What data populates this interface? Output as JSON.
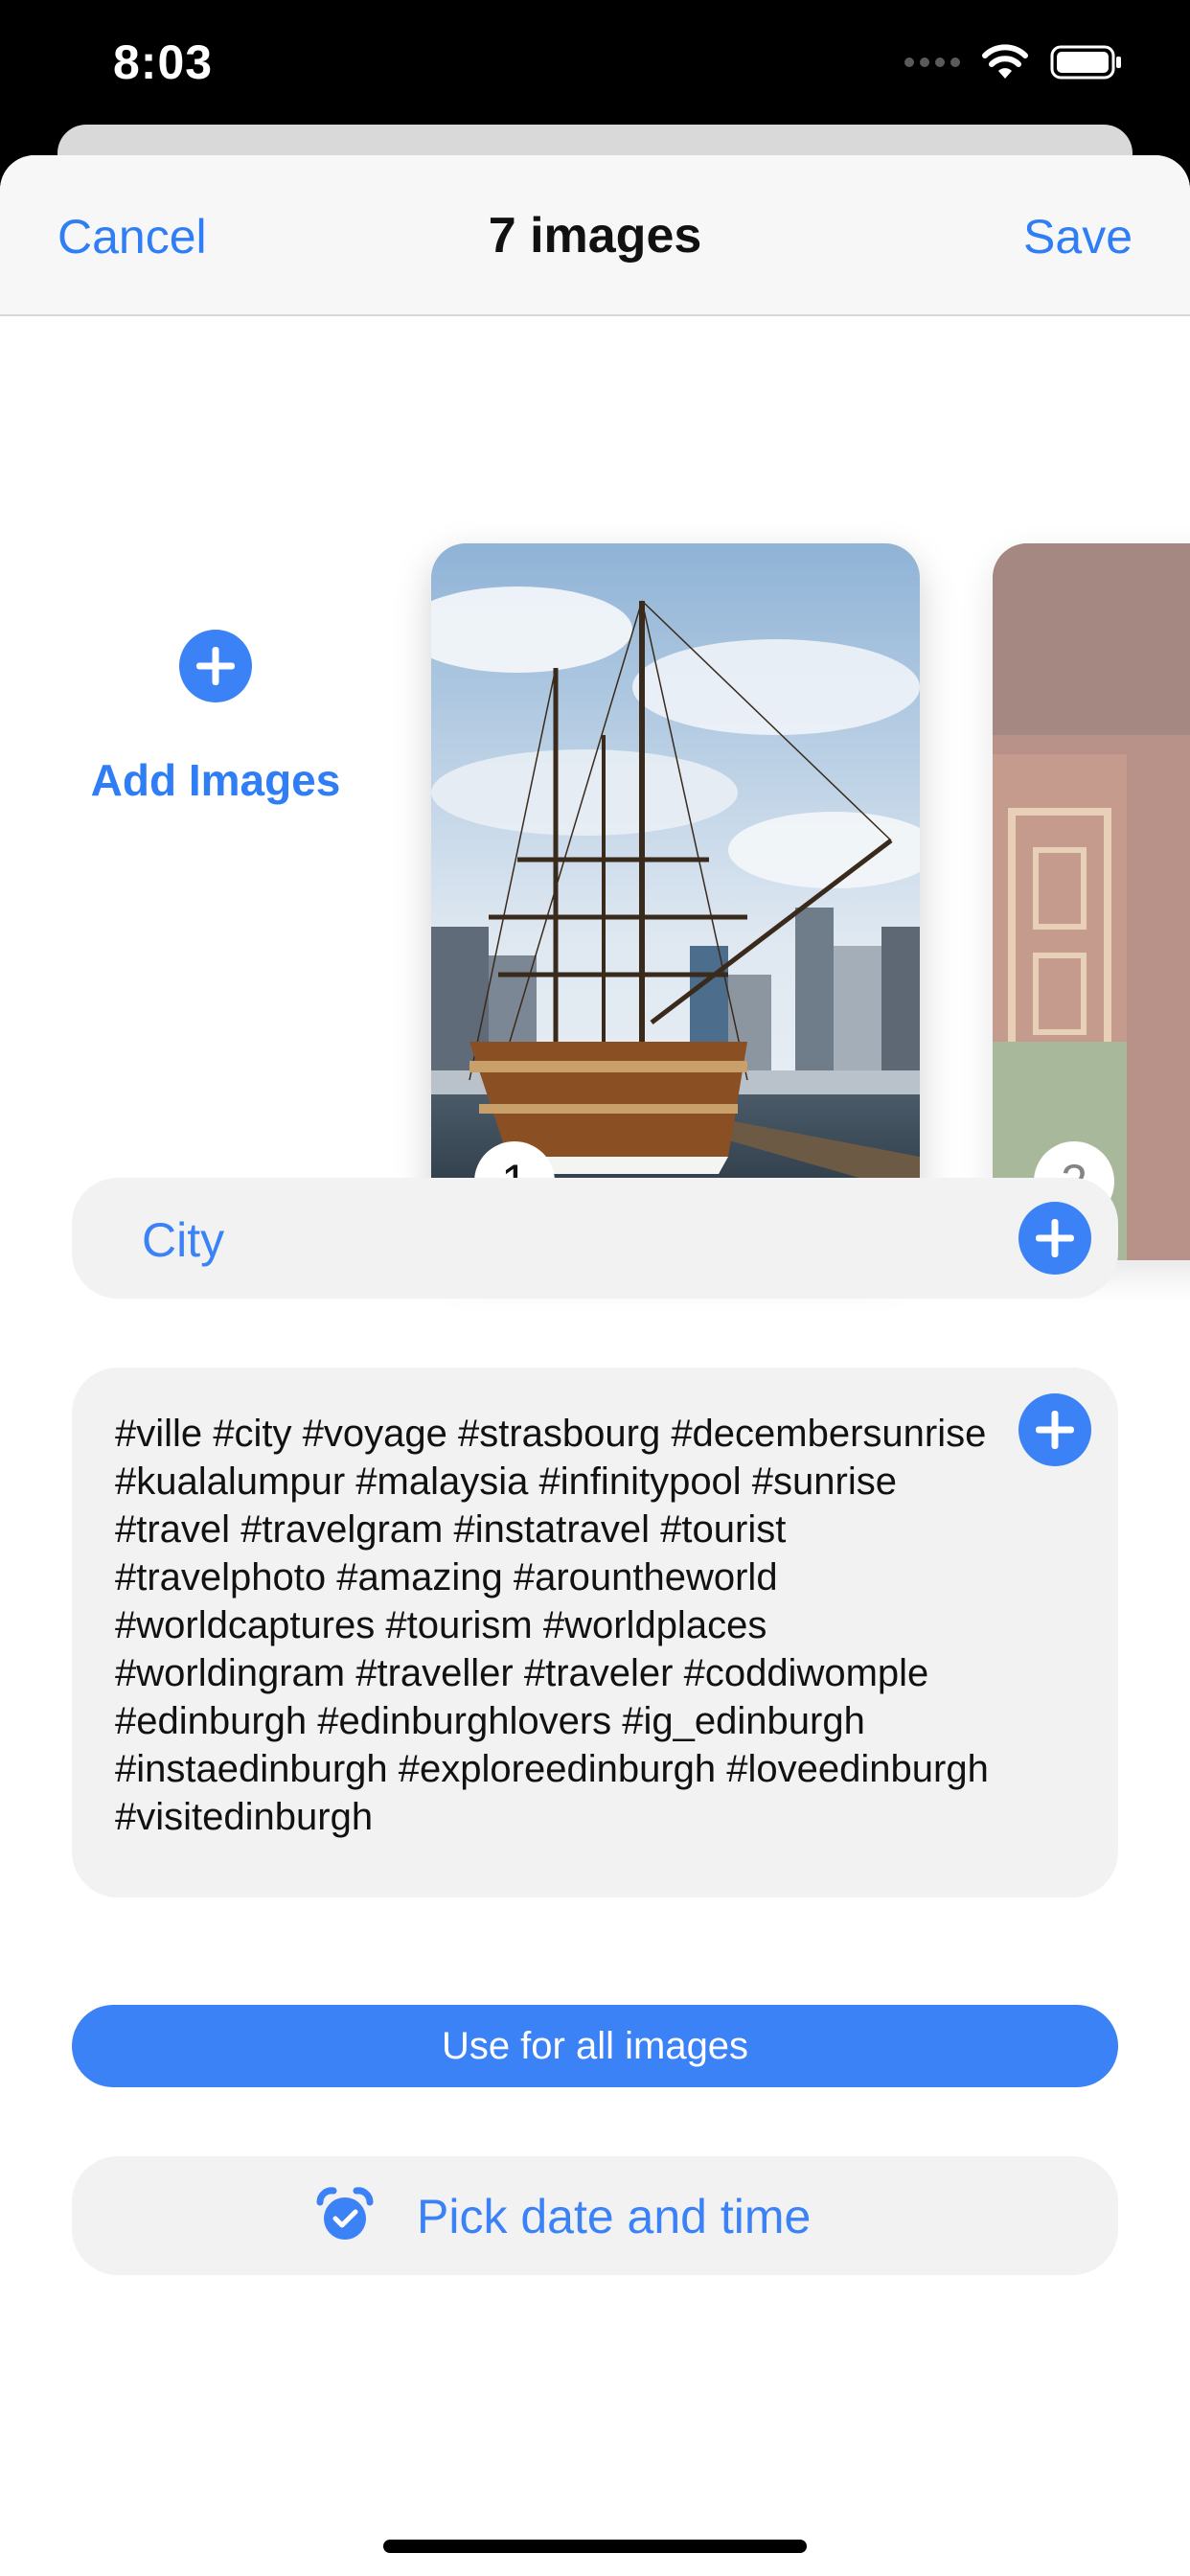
{
  "status_bar": {
    "time": "8:03"
  },
  "nav": {
    "cancel_label": "Cancel",
    "title": "7 images",
    "save_label": "Save"
  },
  "images": {
    "add_label": "Add Images",
    "cards": [
      {
        "badge": "1"
      },
      {
        "badge": "2"
      }
    ]
  },
  "city": {
    "label": "City"
  },
  "hashtags": {
    "text": "#ville #city #voyage #strasbourg #decembersunrise #kualalumpur #malaysia #infinitypool #sunrise #travel #travelgram #instatravel #tourist #travelphoto #amazing #arountheworld #worldcaptures #tourism #worldplaces #worldingram #traveller #traveler #coddiwomple #edinburgh #edinburghlovers #ig_edinburgh #instaedinburgh #exploreedinburgh #loveedinburgh #visitedinburgh"
  },
  "use_all_label": "Use for all images",
  "pick_date_label": "Pick date and time",
  "colors": {
    "accent": "#3B82F6",
    "field_bg": "#F2F2F3"
  }
}
